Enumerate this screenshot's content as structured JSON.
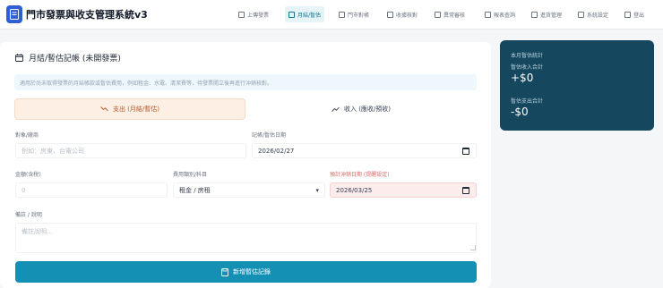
{
  "app": {
    "title": "門市發票與收支管理系統v3"
  },
  "nav": [
    {
      "label": "上傳發票",
      "icon": "upload-icon"
    },
    {
      "label": "月結/暫估",
      "icon": "calendar-icon"
    },
    {
      "label": "門市對帳",
      "icon": "store-icon"
    },
    {
      "label": "收據核對",
      "icon": "refresh-icon"
    },
    {
      "label": "異常審核",
      "icon": "alert-icon"
    },
    {
      "label": "報表查詢",
      "icon": "search-icon"
    },
    {
      "label": "進貨管理",
      "icon": "box-icon"
    },
    {
      "label": "系統設定",
      "icon": "settings-icon"
    },
    {
      "label": "登出",
      "icon": "logout-icon"
    }
  ],
  "form": {
    "section_title": "月結/暫估記帳 (未開發票)",
    "notice": "適用於尚未取得發票的月結帳款或暫估費用，例如租金、水電、清潔費等，待發票開立後再進行沖銷核對。",
    "type_options": {
      "expense": "支出 (月結/暫估)",
      "income": "收入 (應收/預收)"
    },
    "vendor_label": "對象/廠商",
    "vendor_placeholder": "例如：房東、台電公司",
    "date_label": "記帳/暫估日期",
    "date_value": "2026/02/27",
    "amount_label": "金額(含稅)",
    "amount_placeholder": "0",
    "category_label": "費用類別/科目",
    "category_value": "租金 / 房租",
    "due_label": "預計沖銷日期 (提醒設定)",
    "due_value": "2026/03/25",
    "memo_label": "備註 / 說明",
    "memo_placeholder": "備註說明...",
    "submit_label": "新增暫估記錄"
  },
  "summary": {
    "title": "本月暫估統計",
    "income_caption": "暫估收入合計",
    "income_value": "+$0",
    "expense_caption": "暫估支出合計",
    "expense_value": "-$0"
  },
  "colors": {
    "accent": "#1490b5",
    "summary_bg": "#15475e",
    "expense_tint": "#fdefe4",
    "warning_tint": "#fdecec"
  }
}
